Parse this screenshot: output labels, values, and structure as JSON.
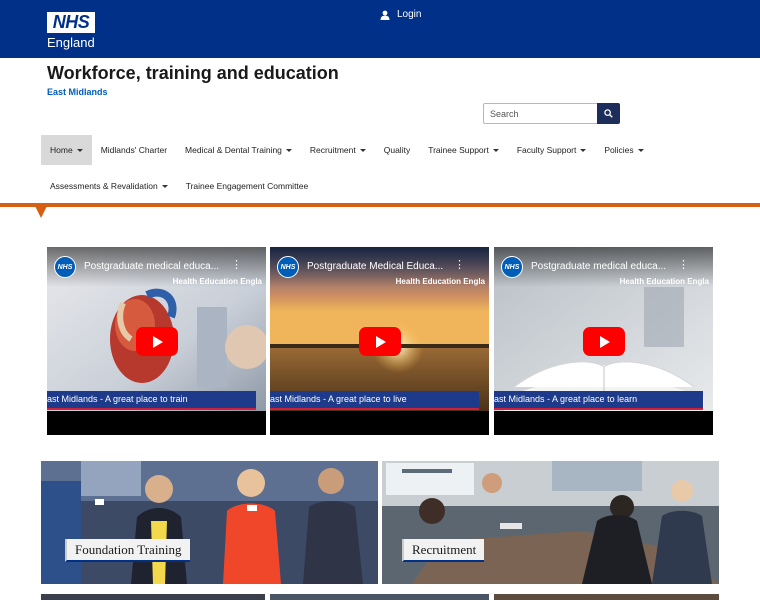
{
  "header": {
    "logo_box": "NHS",
    "logo_text": "England",
    "login_label": "Login"
  },
  "site": {
    "title": "Workforce, training and education",
    "subtitle": "East Midlands"
  },
  "search": {
    "placeholder": "Search"
  },
  "nav": {
    "row1": [
      {
        "label": "Home",
        "dropdown": true,
        "active": true
      },
      {
        "label": "Midlands' Charter",
        "dropdown": false
      },
      {
        "label": "Medical & Dental Training",
        "dropdown": true
      },
      {
        "label": "Recruitment",
        "dropdown": true
      },
      {
        "label": "Quality",
        "dropdown": false
      },
      {
        "label": "Trainee Support",
        "dropdown": true
      },
      {
        "label": "Faculty Support",
        "dropdown": true
      },
      {
        "label": "Policies",
        "dropdown": true
      }
    ],
    "row2": [
      {
        "label": "Assessments & Revalidation",
        "dropdown": true
      },
      {
        "label": "Trainee Engagement Committee",
        "dropdown": false
      }
    ]
  },
  "videos": [
    {
      "channel_icon": "NHS",
      "title": "Postgraduate medical educa...",
      "watermark": "Health Education Engla",
      "banner": "ast Midlands - A great place to train"
    },
    {
      "channel_icon": "NHS",
      "title": "Postgraduate Medical Educa...",
      "watermark": "Health Education Engla",
      "banner": "ast Midlands - A great place to live"
    },
    {
      "channel_icon": "NHS",
      "title": "Postgraduate medical educa...",
      "watermark": "Health Education Engla",
      "banner": "ast Midlands - A great place to learn"
    }
  ],
  "cards": [
    {
      "label": "Foundation Training"
    },
    {
      "label": "Recruitment"
    }
  ],
  "colors": {
    "nhs_blue": "#003087",
    "nhs_light_blue": "#005eb8",
    "accent_orange": "#d65f12",
    "youtube_red": "#ff0000"
  },
  "icons": {
    "login": "user-icon",
    "search": "search-icon",
    "video_menu": "more-vertical-icon",
    "play": "play-icon"
  }
}
